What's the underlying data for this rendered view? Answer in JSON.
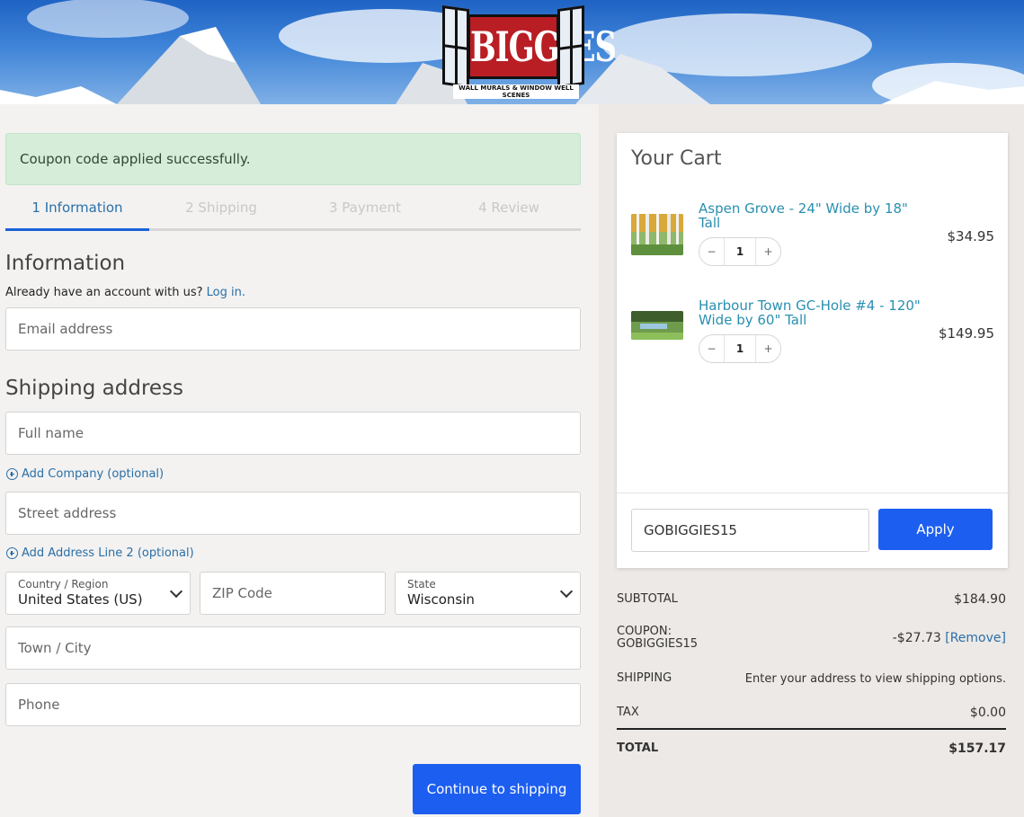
{
  "header": {
    "logo_text": "BIGGIES",
    "logo_tagline": "WALL MURALS & WINDOW WELL SCENES"
  },
  "alert": {
    "message": "Coupon code applied successfully."
  },
  "steps": [
    {
      "label": "1 Information",
      "active": true
    },
    {
      "label": "2 Shipping",
      "active": false
    },
    {
      "label": "3 Payment",
      "active": false
    },
    {
      "label": "4 Review",
      "active": false
    }
  ],
  "information": {
    "heading": "Information",
    "account_prompt": "Already have an account with us?",
    "login_link": "Log in.",
    "email_placeholder": "Email address"
  },
  "shipping": {
    "heading": "Shipping address",
    "full_name_placeholder": "Full name",
    "add_company": "Add Company (optional)",
    "street_placeholder": "Street address",
    "add_line2": "Add Address Line 2 (optional)",
    "country_label": "Country / Region",
    "country_value": "United States (US)",
    "zip_placeholder": "ZIP Code",
    "state_label": "State",
    "state_value": "Wisconsin",
    "city_placeholder": "Town / City",
    "phone_placeholder": "Phone",
    "continue_button": "Continue to shipping"
  },
  "cart": {
    "title": "Your Cart",
    "items": [
      {
        "name": "Aspen Grove - 24\" Wide by 18\" Tall",
        "quantity": "1",
        "price": "$34.95",
        "minus": "−",
        "plus": "+"
      },
      {
        "name": "Harbour Town GC-Hole #4 - 120\" Wide by 60\" Tall",
        "quantity": "1",
        "price": "$149.95",
        "minus": "−",
        "plus": "+"
      }
    ],
    "coupon_value": "GOBIGGIES15",
    "apply_button": "Apply"
  },
  "totals": {
    "subtotal_label": "SUBTOTAL",
    "subtotal_value": "$184.90",
    "coupon_label_line1": "COUPON:",
    "coupon_label_line2": "GOBIGGIES15",
    "coupon_value": "-$27.73",
    "coupon_remove": "[Remove]",
    "shipping_label": "SHIPPING",
    "shipping_value": "Enter your address to view shipping options.",
    "tax_label": "TAX",
    "tax_value": "$0.00",
    "total_label": "TOTAL",
    "total_value": "$157.17"
  },
  "colors": {
    "primary_button": "#1c5ef0",
    "link": "#2a6fa8",
    "alert_bg": "#d5edd9",
    "logo_red": "#b81e24"
  }
}
